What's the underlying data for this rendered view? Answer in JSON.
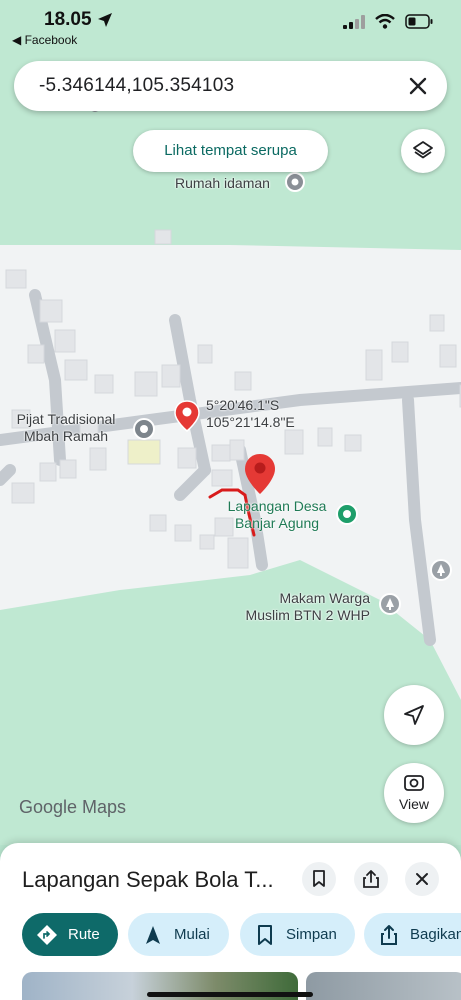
{
  "status_bar": {
    "time": "18.05",
    "back_app": "◀ Facebook"
  },
  "search": {
    "query": "-5.346144,105.354103"
  },
  "chip": {
    "label": "Lihat tempat serupa"
  },
  "map": {
    "labels": {
      "rumah": "Rumah idaman",
      "pijat_line1": "Pijat Tradisional",
      "pijat_line2": "Mbah Ramah",
      "coord_line1": "5°20'46.1\"S",
      "coord_line2": "105°21'14.8\"E",
      "lapangan_line1": "Lapangan Desa",
      "lapangan_line2": "Banjar Agung",
      "makam_line1": "Makam Warga",
      "makam_line2": "Muslim BTN 2 WHP"
    },
    "logo": "Google Maps",
    "view_label": "View"
  },
  "sheet": {
    "title": "Lapangan Sepak Bola T...",
    "buttons": {
      "rute": "Rute",
      "mulai": "Mulai",
      "simpan": "Simpan",
      "bagikan": "Bagikan"
    }
  },
  "colors": {
    "accent": "#0e6a69",
    "pin": "#e53935",
    "park": "#bfe8d2"
  }
}
